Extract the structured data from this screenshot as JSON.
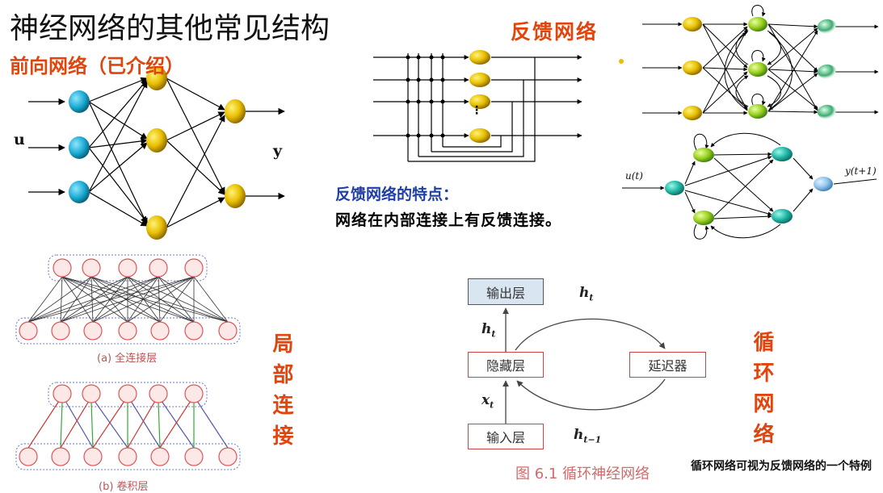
{
  "title": "神经网络的其他常见结构",
  "feedforward": {
    "heading": "前向网络（已介绍）",
    "input_label": "u",
    "output_label": "y"
  },
  "feedback": {
    "heading": "反馈网络",
    "feature_title": "反馈网络的特点：",
    "feature_desc": "网络在内部连接上有反馈连接。",
    "dots": "⋮",
    "ut_label": "u(t)",
    "yt1_label": "y(t+1)"
  },
  "local": {
    "label": "局部连接",
    "caption_a": "(a) 全连接层",
    "caption_b": "(b) 卷积层"
  },
  "rnn": {
    "label": "循环网络",
    "box_output": "输出层",
    "box_hidden": "隐藏层",
    "box_input": "输入层",
    "box_delay": "延迟器",
    "h_t": "h",
    "sub_t": "t",
    "x_t": "x",
    "h_prev_sub": "t−1",
    "figure_caption": "图 6.1  循环神经网络",
    "note": "循环网络可视为反馈网络的一个特例"
  },
  "colors": {
    "accent_red": "#e2440e",
    "blue_text": "#1f3fa8",
    "node_yellow": "#e8c000",
    "node_cyan": "#1aa8cc"
  }
}
